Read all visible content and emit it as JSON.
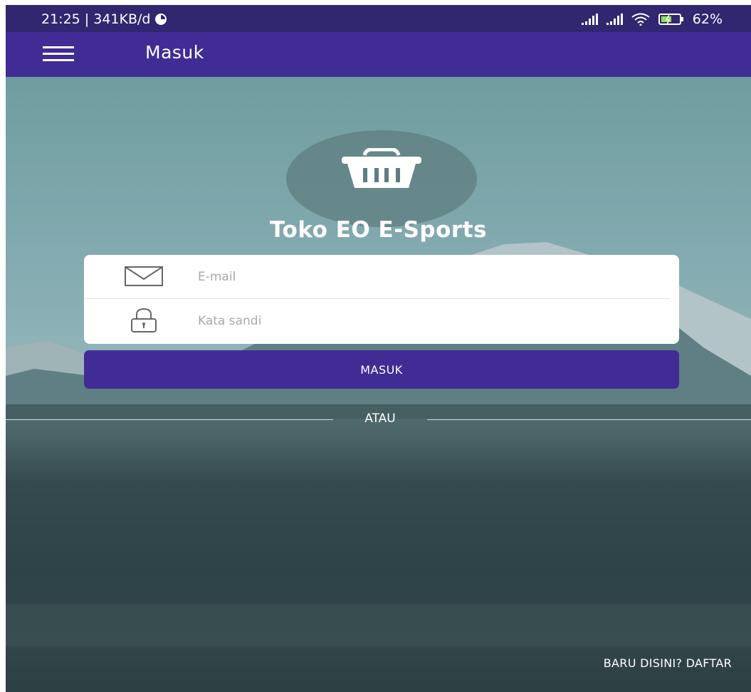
{
  "status_bar": {
    "time_speed": "21:25 | 341KB/d",
    "battery": "62%"
  },
  "app_bar": {
    "title": "Masuk"
  },
  "brand": {
    "name": "Toko EO E-Sports"
  },
  "form": {
    "email_placeholder": "E-mail",
    "email_value": "",
    "password_placeholder": "Kata sandi",
    "password_value": "",
    "login_button": "MASUK"
  },
  "divider": {
    "text": "ATAU"
  },
  "register": {
    "text": "BARU DISINI? DAFTAR"
  },
  "colors": {
    "primary": "#402c94",
    "status_bar": "#312670"
  },
  "icons": [
    "menu-icon",
    "basket-icon",
    "mail-icon",
    "lock-icon",
    "wifi-icon",
    "battery-icon",
    "signal-icon",
    "data-saver-icon"
  ]
}
